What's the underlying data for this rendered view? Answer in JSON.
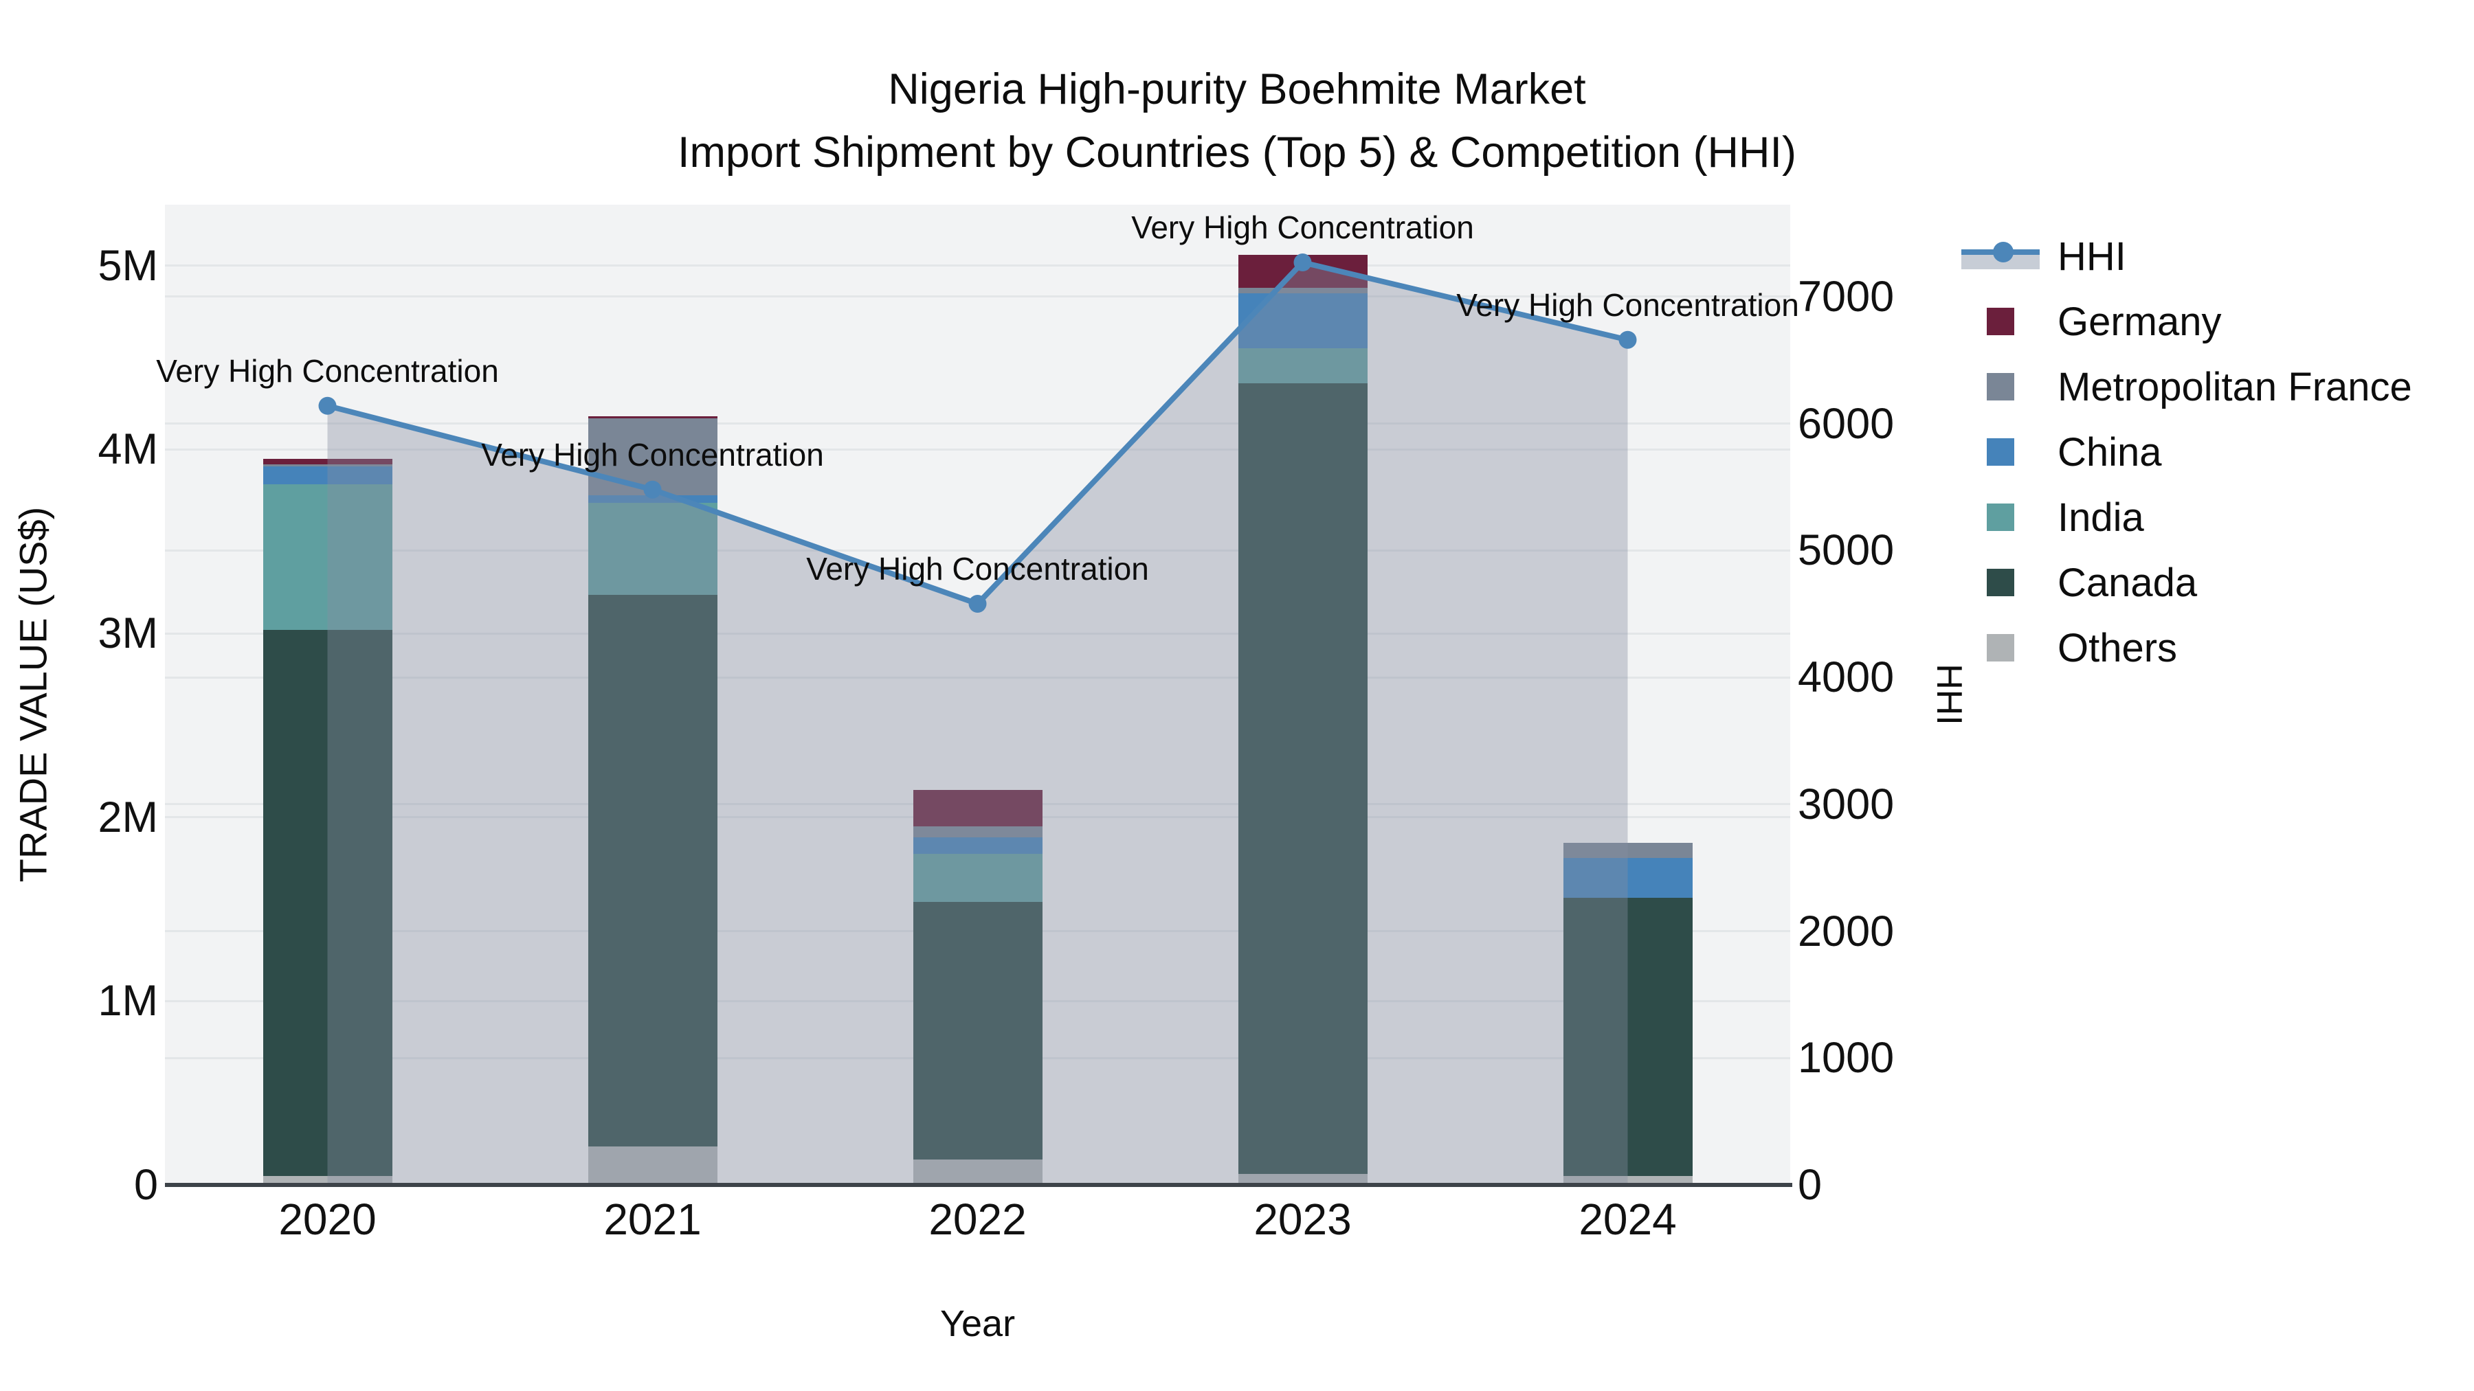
{
  "title": {
    "line1": "Nigeria High-purity Boehmite Market",
    "line2": "Import Shipment by Countries (Top 5) & Competition (HHI)"
  },
  "axes": {
    "left": {
      "title": "TRADE VALUE (US$)",
      "ticks": [
        "0",
        "1M",
        "2M",
        "3M",
        "4M",
        "5M"
      ],
      "tick_values_m": [
        0,
        1,
        2,
        3,
        4,
        5
      ],
      "max_m": 5.332
    },
    "right": {
      "title": "HHI",
      "ticks": [
        "0",
        "1000",
        "2000",
        "3000",
        "4000",
        "5000",
        "6000",
        "7000"
      ],
      "tick_values": [
        0,
        1000,
        2000,
        3000,
        4000,
        5000,
        6000,
        7000
      ],
      "max": 7725
    },
    "x": {
      "title": "Year",
      "ticks": [
        "2020",
        "2021",
        "2022",
        "2023",
        "2024"
      ]
    }
  },
  "legend": {
    "items": [
      {
        "label": "HHI",
        "type": "line",
        "color": "#4c86b9"
      },
      {
        "label": "Germany",
        "type": "square",
        "color": "#6b1f3c"
      },
      {
        "label": "Metropolitan France",
        "type": "square",
        "color": "#7a8696"
      },
      {
        "label": "China",
        "type": "square",
        "color": "#4583ba"
      },
      {
        "label": "India",
        "type": "square",
        "color": "#5f9fa0"
      },
      {
        "label": "Canada",
        "type": "square",
        "color": "#2e4c49"
      },
      {
        "label": "Others",
        "type": "square",
        "color": "#afb3b5"
      }
    ]
  },
  "chart_data": {
    "type": [
      "bar",
      "line"
    ],
    "title": "Nigeria High-purity Boehmite Market — Import Shipment by Countries (Top 5) & Competition (HHI)",
    "categories": [
      "2020",
      "2021",
      "2022",
      "2023",
      "2024"
    ],
    "bar_mode": "stacked",
    "bar_unit": "million US$",
    "series": [
      {
        "name": "Others",
        "color": "#afb3b5",
        "values": [
          0.05,
          0.21,
          0.14,
          0.06,
          0.05
        ]
      },
      {
        "name": "Canada",
        "color": "#2e4c49",
        "values": [
          2.97,
          3.0,
          1.4,
          4.3,
          1.51
        ]
      },
      {
        "name": "India",
        "color": "#5f9fa0",
        "values": [
          0.79,
          0.5,
          0.26,
          0.19,
          0
        ]
      },
      {
        "name": "China",
        "color": "#4583ba",
        "values": [
          0.1,
          0.04,
          0.09,
          0.3,
          0.22
        ]
      },
      {
        "name": "Metropolitan France",
        "color": "#7a8696",
        "values": [
          0.01,
          0.42,
          0.06,
          0.03,
          0.08
        ]
      },
      {
        "name": "Germany",
        "color": "#6b1f3c",
        "values": [
          0.03,
          0.01,
          0.2,
          0.18,
          0
        ]
      }
    ],
    "line_series": {
      "name": "HHI",
      "color": "#4c86b9",
      "fill_color": "rgba(133,143,161,0.38)",
      "axis": "right",
      "values": [
        6140,
        5480,
        4580,
        7270,
        6660
      ]
    },
    "annotations": [
      {
        "x": "2020",
        "text": "Very High Concentration"
      },
      {
        "x": "2021",
        "text": "Very High Concentration"
      },
      {
        "x": "2022",
        "text": "Very High Concentration"
      },
      {
        "x": "2023",
        "text": "Very High Concentration"
      },
      {
        "x": "2024",
        "text": "Very High Concentration"
      }
    ],
    "xlabel": "Year",
    "ylabel_left": "TRADE VALUE (US$)",
    "ylabel_right": "HHI",
    "ylim_left_m": [
      0,
      5.332
    ],
    "ylim_right": [
      0,
      7725
    ],
    "grid": true,
    "legend_position": "outside-top-right",
    "plot_background": "#f2f3f4"
  }
}
